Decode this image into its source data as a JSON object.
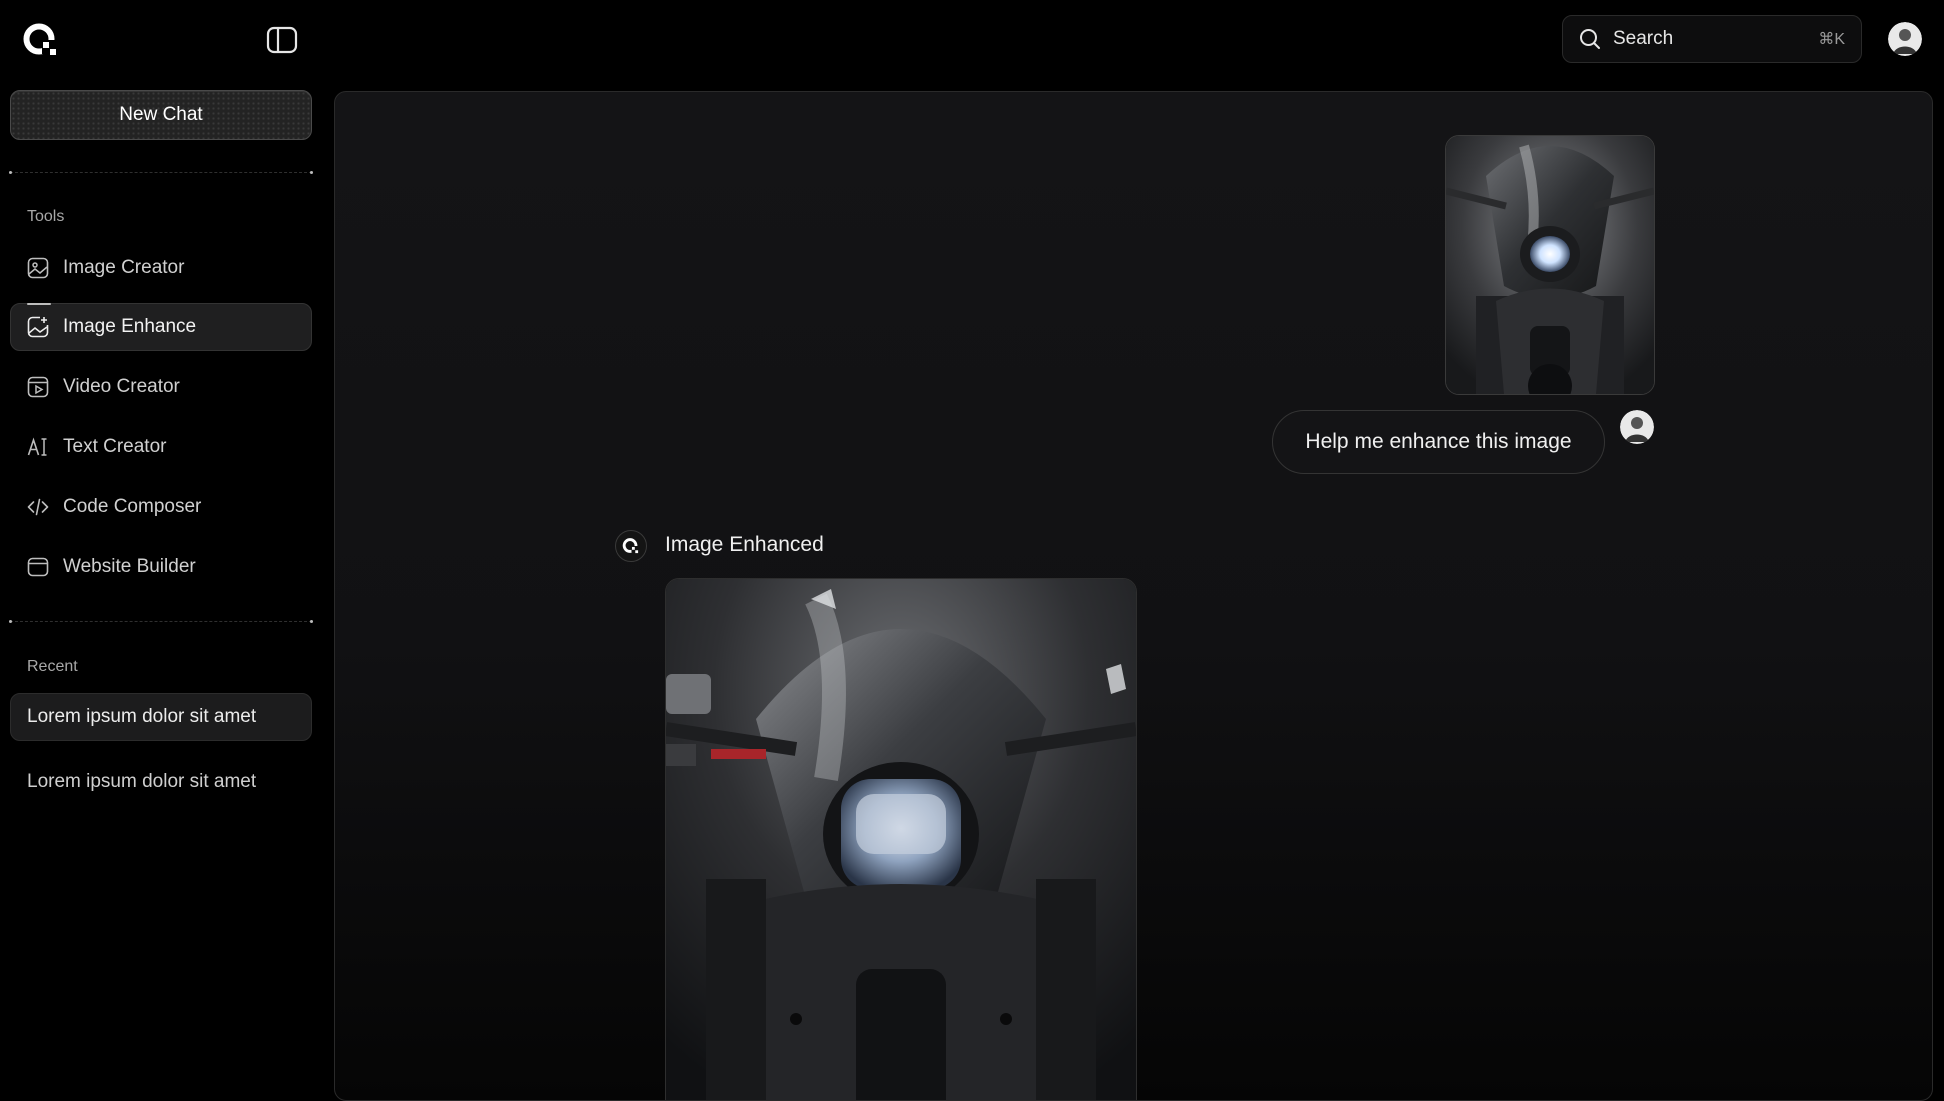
{
  "header": {
    "logo_icon": "brand-logo-icon",
    "sidebar_toggle_icon": "sidebar-toggle-icon",
    "search": {
      "label": "Search",
      "shortcut": "⌘K",
      "icon": "search-icon"
    },
    "avatar_icon": "user-avatar-icon"
  },
  "sidebar": {
    "new_chat_label": "New Chat",
    "tools_label": "Tools",
    "tools": [
      {
        "label": "Image Creator",
        "icon": "image-icon",
        "active": false
      },
      {
        "label": "Image Enhance",
        "icon": "image-enhance-icon",
        "active": true
      },
      {
        "label": "Video Creator",
        "icon": "video-icon",
        "active": false
      },
      {
        "label": "Text Creator",
        "icon": "text-icon",
        "active": false
      },
      {
        "label": "Code Composer",
        "icon": "code-icon",
        "active": false
      },
      {
        "label": "Website Builder",
        "icon": "browser-window-icon",
        "active": false
      }
    ],
    "recent_label": "Recent",
    "recent": [
      {
        "label": "Lorem ipsum dolor sit amet",
        "active": true
      },
      {
        "label": "Lorem ipsum dolor sit amet",
        "active": false
      }
    ]
  },
  "chat": {
    "user_message": "Help me enhance this image",
    "user_image": "motorcycle-headlight-photo",
    "ai_title": "Image Enhanced",
    "ai_image": "motorcycle-headlight-enhanced-photo"
  },
  "colors": {
    "background": "#000000",
    "panel": "#121214",
    "accent": "#ffffff"
  }
}
